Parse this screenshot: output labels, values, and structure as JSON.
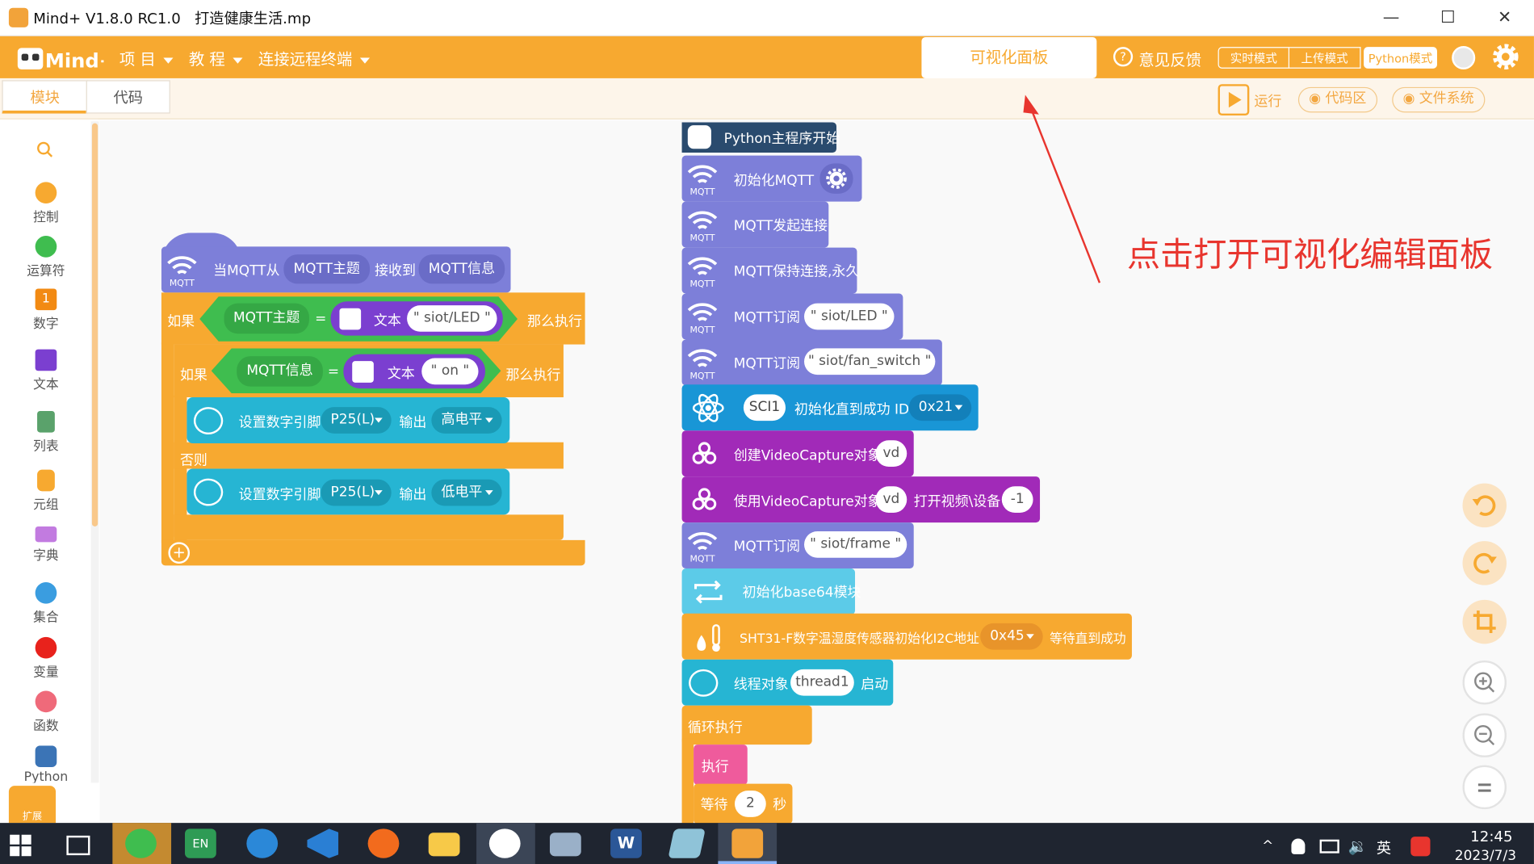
{
  "window": {
    "title": "Mind+ V1.8.0 RC1.0   打造健康生活.mp",
    "minimize": "—",
    "maximize": "☐",
    "close": "✕"
  },
  "menu": {
    "items": [
      {
        "label": "项 目"
      },
      {
        "label": "教 程"
      },
      {
        "label": "连接远程终端"
      }
    ],
    "visual_panel": "可视化面板",
    "feedback": "意见反馈",
    "modes": [
      "实时模式",
      "上传模式",
      "Python模式"
    ]
  },
  "tabs": {
    "blocks": "模块",
    "code": "代码"
  },
  "toolbar": {
    "run": "运行",
    "code_area": "代码区",
    "filesystem": "文件系统"
  },
  "sidebar": {
    "categories": [
      {
        "label": "控制",
        "color": "#f7a930"
      },
      {
        "label": "运算符",
        "color": "#3fbd4f"
      },
      {
        "label": "数字",
        "color": "#f28a13"
      },
      {
        "label": "文本",
        "color": "#7b3fd0"
      },
      {
        "label": "列表",
        "color": "#5aa26b"
      },
      {
        "label": "元组",
        "color": "#f7a930"
      },
      {
        "label": "字典",
        "color": "#c27be0"
      },
      {
        "label": "集合",
        "color": "#3a9de0"
      },
      {
        "label": "变量",
        "color": "#e8221c"
      },
      {
        "label": "函数",
        "color": "#ef6a7a"
      },
      {
        "label": "Python",
        "color": "#3b74b6"
      }
    ],
    "number_glyph": "1",
    "extend": "扩展"
  },
  "annotation": "点击打开可视化编辑面板",
  "left_script": {
    "hat": {
      "prefix": "当MQTT从",
      "topic": "MQTT主题",
      "mid": "接收到",
      "msg": "MQTT信息"
    },
    "if1": {
      "kw": "如果",
      "topic": "MQTT主题",
      "eq": "=",
      "text": "文本",
      "value": "siot/LED",
      "then": "那么执行"
    },
    "if2": {
      "kw": "如果",
      "msg": "MQTT信息",
      "eq": "=",
      "text": "文本",
      "value": "on",
      "then": "那么执行"
    },
    "set1": {
      "label": "设置数字引脚",
      "pin": "P25(L)",
      "out": "输出",
      "level": "高电平"
    },
    "else": "否则",
    "set2": {
      "label": "设置数字引脚",
      "pin": "P25(L)",
      "out": "输出",
      "level": "低电平"
    }
  },
  "right_script": {
    "start": "Python主程序开始",
    "init_mqtt": "初始化MQTT",
    "connect": "MQTT发起连接",
    "keepalive": "MQTT保持连接,永久",
    "sub1": {
      "label": "MQTT订阅",
      "topic": "siot/LED"
    },
    "sub2": {
      "label": "MQTT订阅",
      "topic": "siot/fan_switch"
    },
    "sci": {
      "port": "SCI1",
      "label": "初始化直到成功 ID:",
      "id": "0x21"
    },
    "vc_create": {
      "label": "创建VideoCapture对象",
      "var": "vd"
    },
    "vc_open": {
      "label": "使用VideoCapture对象",
      "var": "vd",
      "mid": "打开视频\\设备",
      "dev": "-1"
    },
    "sub3": {
      "label": "MQTT订阅",
      "topic": "siot/frame"
    },
    "b64": "初始化base64模块",
    "sht": {
      "label": "SHT31-F数字温湿度传感器初始化I2C地址",
      "addr": "0x45",
      "tail": "等待直到成功"
    },
    "thread": {
      "label": "线程对象",
      "name": "thread1",
      "tail": "启动"
    },
    "loop": "循环执行",
    "exec": "执行",
    "wait": {
      "label": "等待",
      "value": "2",
      "unit": "秒"
    }
  },
  "mqtt_icon_text": "MQTT",
  "taskbar": {
    "time": "12:45",
    "date": "2023/7/3",
    "lang": "英",
    "apps": [
      "WeChat",
      "EN",
      "Edge",
      "VSCode",
      "Firefox",
      "Explorer",
      "Paint",
      "Monitor",
      "Word",
      "Notes",
      "Mind+"
    ],
    "word_letter": "W",
    "en_label": "EN"
  }
}
